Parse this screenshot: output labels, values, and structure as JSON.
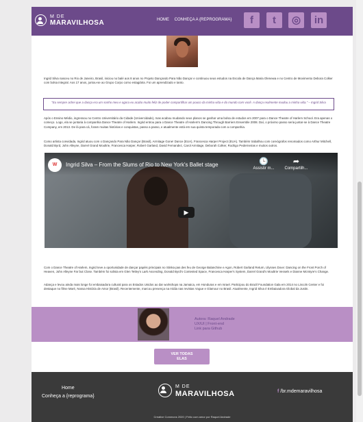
{
  "header": {
    "logo_small": "M DE",
    "logo_big": "MARAVILHOSA",
    "nav": [
      "HOME",
      "CONHEÇA A {REPROGRAMA}"
    ],
    "social": [
      {
        "name": "facebook",
        "glyph": "f"
      },
      {
        "name": "twitter",
        "glyph": "t"
      },
      {
        "name": "instagram",
        "glyph": "◎"
      },
      {
        "name": "linkedin",
        "glyph": "in"
      }
    ]
  },
  "article": {
    "intro": "Ingrid Silva nasceu no Rio de Janeiro, Brasil, iniciou no balé aos 8 anos no Projeto Dançando Para Não Dançar e continuou seus estudos na Escola de Dança Maria Olenewa e no Centro de Movimento Debora Colker com bolsa integral. Aos 17 anos, juntou-se ao Grupo Corpo como estagiária. Foi um aprendizado e tanto.",
    "quote": "\"Eu sempre achei que a dança era um sonho meu e agora eu acabo muito feliz de poder compartilhar um pouco da minha vida e do mundo com você. A dança realmente mudou a minha vida.\" – Ingrid Silva",
    "p2": "Após o Ensino Médio, ingressou no Centro Universitário da Cidade (Univercidade), mas acabou mudando seus planos se ganhar uma bolsa de estudos em 2007 para o Dance Theatre of Harlem School. Era apenas o começo. Logo, ela se juntaria à companhia Dance Theatre of Harlem. Ingrid entrou para o Dance Theatre of Harlem's Dancing Through Barriers Ensemble 2008. Daí, o próximo passo seria juntar-se à Dance Theatre Company, em 2013. De lá para cá, foram muitas histórias e conquistas, passo a passo, e atualmente está em sua quinta temporada com a companhia.",
    "p3": "Como artista convidada, Ingrid atuou com o Dançando Para Não Dançar (Brasil), Armitage Gone! Dance (EUA), Francesca Harper Project (EUA). Também trabalhou com coreógrafos renomados como Arthur Mitchell, Donald Byrd, John Alleyne, Darrel Grand Moultrie, Francesca Harper, Robert Garland, David Fernandez, Carol Armitage, Deborah Colker, Rodrigo Pederneiras e muitos outros.",
    "p4": "Com o Dance Theatre of Harlem, Ingrid teve a oportunidade de dançar papéis principais no Stinka pas des feu de George Balanchine e Agon, Robert Garland Return, Ulysses Dove: Dancing on the Front Porch of Heaven, John Alleyne Far but Close. Também foi solista em Glen Tetley's Lark Ascending, Donald Byrd's Contested Space, Francesca Harper's System, Darrel Grand's Moultrie Vessels e Dianne McIntyre's Change.",
    "p5": "Adança e levou ainda mais longe foi embaixadora cultural para os Estados Unidos ao dar workshops na Jamaica, em Honduras e em Israel. Participou do Brazil Foundation Gala em 2014 no Lincoln Center e foi destaque no filme Maré, Nossa História de Amor (Brasil). Recentemente, marcou presença na mídia nas revistas Vogue e Glamour no Brasil. Atualmente, Ingrid Silva é Embaixadora Global da Justin."
  },
  "video": {
    "channel": "W",
    "title": "Ingrid Silva – From the Slums of Rio to New York's Ballet stage",
    "watch_later": "Assistir m...",
    "share": "Compartilh..."
  },
  "author": {
    "name": "Autora: Raquel Andrade",
    "role": "UX/UI | Front-end",
    "link": "Link para Github"
  },
  "button": {
    "label": "VER TODAS ELAS"
  },
  "footer": {
    "links": [
      "Home",
      "Conheça a {reprograma}"
    ],
    "logo_small": "M DE",
    "logo_big": "MARAVILHOSA",
    "instagram": "/br.mdemaravilhosa",
    "copyright": "Creative Commons 2020 | Feito com amor por Raquel Andrade"
  },
  "colors": {
    "header_purple": "#6c4a8a",
    "accent_lilac": "#b98fc5",
    "footer_dark": "#3a3a3a"
  }
}
